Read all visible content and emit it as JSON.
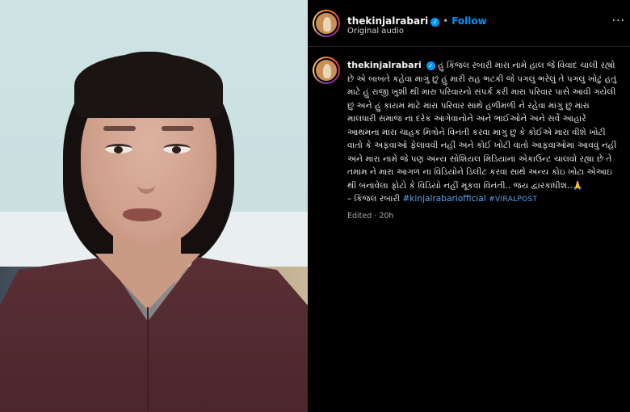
{
  "post": {
    "username": "thekinjalrabari",
    "verified_glyph": "✓",
    "separator": "•",
    "follow_label": "Follow",
    "audio_label": "Original audio",
    "more_label": "···"
  },
  "caption": {
    "username": "thekinjalrabari",
    "text": "હું કિંજલ રબારી મારા નામે હાલ જે વિવાદ ચાલી રહ્યો છે એ બાબતે કહેવા માગું છું હું મારી રાહ ભટકી જે પગલું ભરેલું તે પગલું ખોટું હતું માટે હું રાજી ખુશી થી મારા પરિવારનો સંપર્ક કરી મારા પરિવાર પાસે આવી ગયેલી છું અને હું કાયમ માટે મારા પરિવાર સાથે હળીમળી ને રહેવા માંગુ છું મારા માલધારી સમાજ ના દરેક આગેવાનોને અને ભાઈઓને અને સર્વે આહારે આથમના મારા ચાહક મિત્રોને વિનંતી કરવા માગું છું કે કોઈએ મારા વીશે ખોટી વાતો કે અફવાઓ ફેલાવવી નહીં અને કોઈ ખોટી વાતો આફવાઓમાં આવવું નહીં અને મારા નામે જે પણ અન્ય સોશિયલ મિડિયાના એકાઉન્ટ ચાલવો રહ્યા છે તે તમામ ને મારા આગળ ના વિડિયોને ડિલીટ કરવા સાથે અન્ય કોઇ ખોટા એઆઇ થી બનાવેલા ફોટો કે વિડિયો નહીં મૂકવા વિનંતી.. જય દ્વારકાધીશ..🙏",
    "signature": "– કિંજલ રબારી",
    "hashtag_1": "#kinjalrabariofficial",
    "hashtag_2": "#VIRALPOST",
    "edited": "Edited",
    "time_ago": "20h"
  },
  "colors": {
    "background": "#000000",
    "link_blue": "#0095f6",
    "hashtag": "#5aa4f0",
    "muted": "#a8a8a8"
  },
  "icons": [
    "verified-badge-icon",
    "more-options-icon",
    "folded-hands-emoji"
  ]
}
